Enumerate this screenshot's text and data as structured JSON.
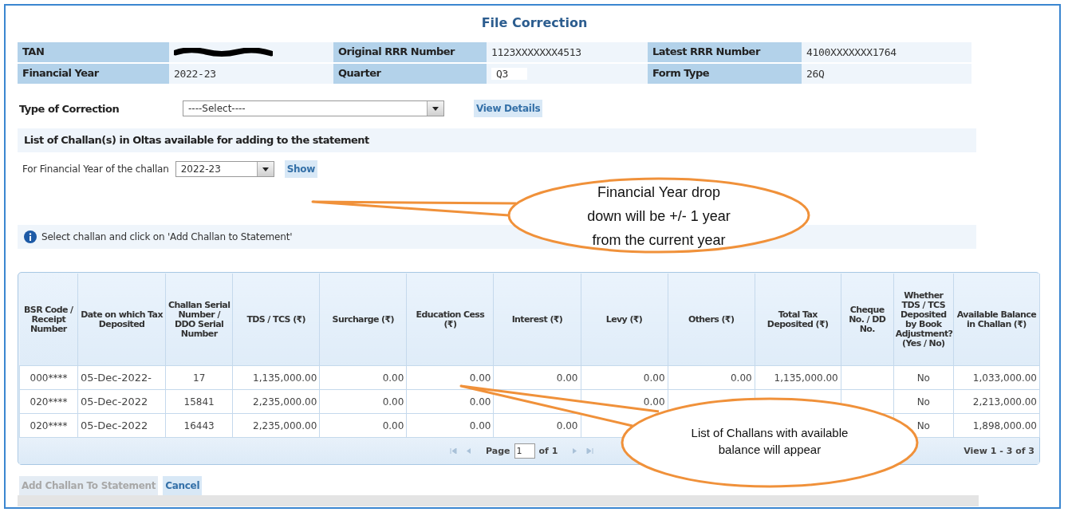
{
  "title": "File Correction",
  "details": [
    {
      "label": "TAN",
      "redacted": true
    },
    {
      "label": "Original RRR Number",
      "value": "1123XXXXXXX4513",
      "redacted": false
    },
    {
      "label": "Latest RRR Number",
      "value": "4100XXXXXXX1764",
      "redacted": false
    },
    {
      "label": "Financial Year",
      "value": "2022-23",
      "redacted": false
    },
    {
      "label": "Quarter",
      "value": "Q3",
      "redacted": false
    },
    {
      "label": "Form Type",
      "value": "26Q",
      "redacted": false
    }
  ],
  "correction": {
    "label": "Type of Correction",
    "select": "----Select----",
    "button": "View Details"
  },
  "challan_section": {
    "heading": "List of Challan(s) in Oltas available for adding to the statement",
    "year_label": "For Financial Year of the challan",
    "year_value": "2022-23",
    "show_button": "Show"
  },
  "info": "Select challan and click on 'Add Challan to Statement'",
  "table": {
    "columns": [
      "BSR Code / Receipt Number",
      "Date on which Tax Deposited",
      "Challan Serial Number / DDO Serial Number",
      "TDS / TCS (₹)",
      "Surcharge (₹)",
      "Education Cess (₹)",
      "Interest (₹)",
      "Levy (₹)",
      "Others (₹)",
      "Total Tax Deposited (₹)",
      "Cheque No. / DD No.",
      "Whether TDS / TCS Deposited by Book Adjustment? (Yes / No)",
      "Available Balance in Challan (₹)"
    ],
    "rows": [
      [
        "000****",
        "05-Dec-2022-",
        "17",
        "1,135,000.00",
        "0.00",
        "0.00",
        "0.00",
        "0.00",
        "0.00",
        "1,135,000.00",
        null,
        "No",
        "1,033,000.00"
      ],
      [
        "020****",
        "05-Dec-2022",
        "15841",
        "2,235,000.00",
        "0.00",
        "0.00",
        null,
        "0.00",
        null,
        null,
        null,
        "No",
        "2,213,000.00"
      ],
      [
        "020****",
        "05-Dec-2022",
        "16443",
        "2,235,000.00",
        "0.00",
        "0.00",
        "0.00",
        null,
        null,
        null,
        null,
        "No",
        "1,898,000.00"
      ]
    ]
  },
  "pager": {
    "page_label": "Page",
    "page": "1",
    "total": "of 1",
    "view": "View 1 - 3 of 3"
  },
  "buttons": [
    {
      "label": "Add Challan To Statement",
      "disabled": true
    },
    {
      "label": "Cancel",
      "disabled": false
    }
  ],
  "callouts": [
    {
      "text": "Financial Year drop down will be +/- 1 year from the current year"
    },
    {
      "text": "List of Challans with available balance will appear"
    }
  ]
}
